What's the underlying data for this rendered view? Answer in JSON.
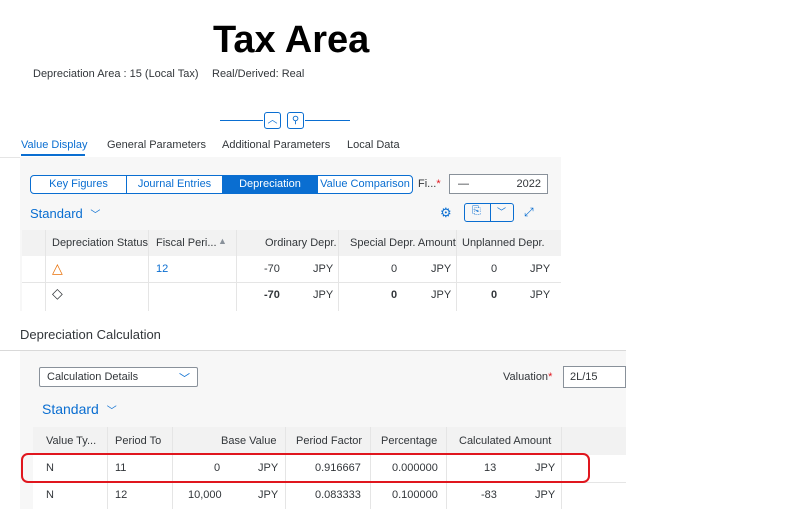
{
  "header": {
    "title": "Tax Area",
    "depreciation_area": "Depreciation Area : 15 (Local Tax)",
    "real_derived": "Real/Derived: Real"
  },
  "tabs": [
    "Value Display",
    "General Parameters",
    "Additional Parameters",
    "Local Data"
  ],
  "segments": [
    "Key Figures",
    "Journal Entries",
    "Depreciation",
    "Value Comparison"
  ],
  "fiscal_year": {
    "label": "Fi...",
    "required": "*",
    "dash": "—",
    "value": "2022"
  },
  "top_table": {
    "variant": "Standard",
    "columns": [
      "Depreciation Status",
      "Fiscal Peri...",
      "Ordinary Depr.",
      "Special Depr. Amount",
      "Unplanned Depr."
    ],
    "rows": [
      {
        "status_icon": "warning-triangle-icon",
        "status_glyph": "△",
        "period": "12",
        "ordinary": "-70",
        "ord_cur": "JPY",
        "special": "0",
        "spec_cur": "JPY",
        "unplanned": "0",
        "unpl_cur": "JPY"
      },
      {
        "status_icon": "diamond-icon",
        "status_glyph": "◇",
        "period": "",
        "ordinary": "-70",
        "ord_cur": "JPY",
        "special": "0",
        "spec_cur": "JPY",
        "unplanned": "0",
        "unpl_cur": "JPY"
      }
    ]
  },
  "calc": {
    "section_title": "Depreciation Calculation",
    "dropdown_value": "Calculation Details",
    "valuation_label": "Valuation",
    "valuation_required": "*",
    "valuation_value": "2L/15",
    "variant": "Standard",
    "columns": [
      "Value Ty...",
      "Period To",
      "Base Value",
      "Period Factor",
      "Percentage",
      "Calculated Amount"
    ],
    "rows": [
      {
        "type": "N",
        "period_to": "11",
        "base": "0",
        "base_cur": "JPY",
        "factor": "0.916667",
        "percentage": "0.000000",
        "amount": "13",
        "amount_cur": "JPY"
      },
      {
        "type": "N",
        "period_to": "12",
        "base": "10,000",
        "base_cur": "JPY",
        "factor": "0.083333",
        "percentage": "0.100000",
        "amount": "-83",
        "amount_cur": "JPY"
      }
    ]
  },
  "colors": {
    "accent": "#0a6ed1",
    "highlight": "#e0161e",
    "warning": "#e9730c"
  }
}
